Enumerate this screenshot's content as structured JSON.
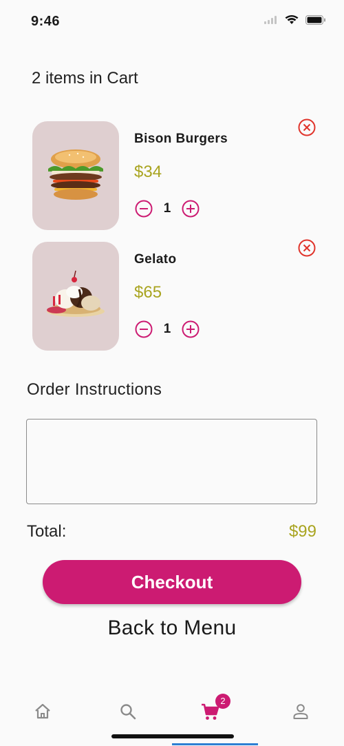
{
  "status": {
    "time": "9:46"
  },
  "cart": {
    "title": "2 items in Cart"
  },
  "items": [
    {
      "name": "Bison Burgers",
      "price": "$34",
      "quantity": "1",
      "image": "burger-image"
    },
    {
      "name": "Gelato",
      "price": "$65",
      "quantity": "1",
      "image": "sundae-image"
    }
  ],
  "instructions": {
    "label": "Order Instructions",
    "value": "",
    "placeholder": ""
  },
  "total": {
    "label": "Total:",
    "value": "$99"
  },
  "actions": {
    "checkout": "Checkout",
    "back": "Back to Menu"
  },
  "nav": {
    "items": [
      "home-icon",
      "search-icon",
      "cart-icon",
      "person-icon"
    ],
    "active": "cart-icon",
    "cart_badge": "2"
  },
  "colors": {
    "accent": "#cc1b72",
    "price": "#a9a420",
    "remove": "#e0342b",
    "thumb_bg": "#dfcfd0",
    "active_indicator": "#2d7fd3"
  }
}
